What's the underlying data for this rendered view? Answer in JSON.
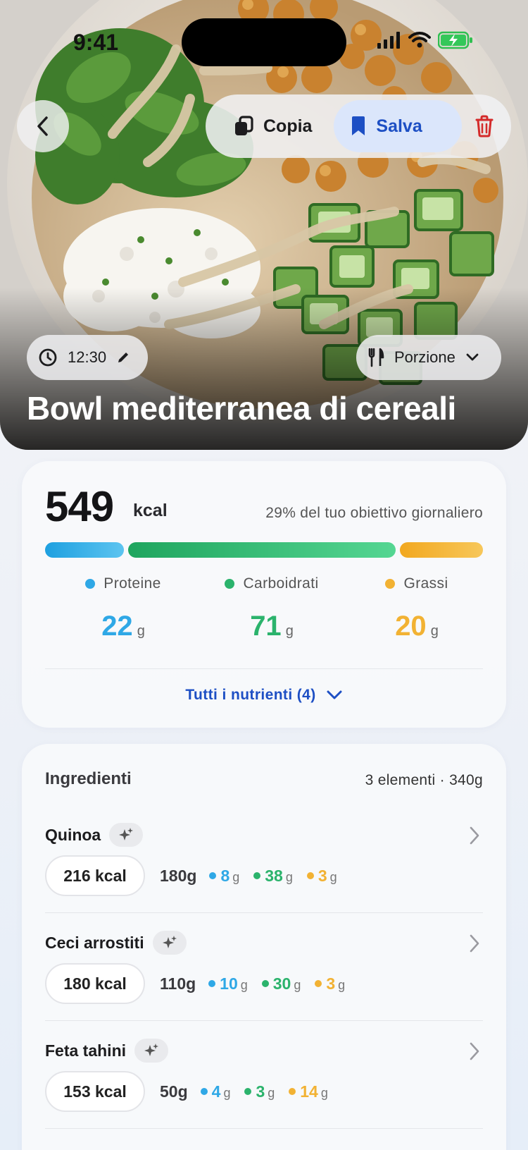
{
  "status_bar": {
    "time": "9:41"
  },
  "header": {
    "copy_label": "Copia",
    "save_label": "Salva",
    "time_chip": "12:30",
    "portion_chip": "Porzione",
    "title": "Bowl mediterranea di cereali"
  },
  "nutrition": {
    "kcal": "549",
    "kcal_unit": "kcal",
    "goal_text": "29% del tuo obiettivo giornaliero",
    "macros": [
      {
        "label": "Proteine",
        "value": "22",
        "unit": "g",
        "color": "#2fa8e6"
      },
      {
        "label": "Carboidrati",
        "value": "71",
        "unit": "g",
        "color": "#2bb36c"
      },
      {
        "label": "Grassi",
        "value": "20",
        "unit": "g",
        "color": "#f2b233"
      }
    ],
    "bar_fractions": [
      0.19,
      0.62,
      0.19
    ],
    "all_nutrients_label": "Tutti i nutrienti (4)"
  },
  "ingredients": {
    "title": "Ingredienti",
    "meta": "3 elementi · 340g",
    "items": [
      {
        "name": "Quinoa",
        "kcal": "216 kcal",
        "grams": "180g",
        "protein": "8",
        "carbs": "38",
        "fat": "3",
        "unit": "g"
      },
      {
        "name": "Ceci arrostiti",
        "kcal": "180 kcal",
        "grams": "110g",
        "protein": "10",
        "carbs": "30",
        "fat": "3",
        "unit": "g"
      },
      {
        "name": "Feta tahini",
        "kcal": "153 kcal",
        "grams": "50g",
        "protein": "4",
        "carbs": "3",
        "fat": "14",
        "unit": "g"
      }
    ]
  },
  "colors": {
    "accent_blue": "#1d4fc4",
    "protein": "#2fa8e6",
    "carbs": "#2bb36c",
    "fat": "#f2b233",
    "delete": "#d42a2a"
  },
  "icons": [
    "chevron-left-icon",
    "copy-icon",
    "bookmark-icon",
    "trash-icon",
    "clock-icon",
    "pencil-icon",
    "fork-knife-icon",
    "chevron-down-icon",
    "sparkle-icon",
    "chevron-right-icon",
    "signal-icon",
    "wifi-icon",
    "battery-icon"
  ]
}
